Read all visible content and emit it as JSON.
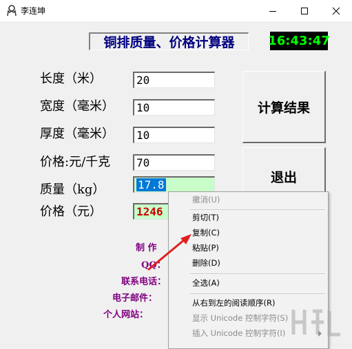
{
  "window": {
    "title": "李连坤",
    "icons": {
      "app": "person-icon",
      "minimize": "minimize-icon",
      "maximize": "maximize-icon",
      "close": "close-icon"
    }
  },
  "header": {
    "heading": "铜排质量、价格计算器",
    "clock": "16:43:47"
  },
  "form": {
    "length_label": "长度（米）",
    "length_value": "20",
    "width_label": "宽度（毫米）",
    "width_value": "10",
    "thickness_label": "厚度（毫米）",
    "thickness_value": "10",
    "price_label": "价格:元/千克",
    "price_value": "70",
    "mass_label": "质量（kg）",
    "mass_value": "17.8",
    "total_label": "价格（元）",
    "total_value": "1246"
  },
  "buttons": {
    "calculate": "计算结果",
    "exit": "退出"
  },
  "info": {
    "author": "制 作",
    "qq": "QQ：",
    "phone": "联系电话：",
    "email": "电子邮件：",
    "website": "个人网站："
  },
  "context_menu": {
    "items": [
      {
        "label": "撤消(U)",
        "enabled": false
      },
      {
        "label": "剪切(T)",
        "enabled": true
      },
      {
        "label": "复制(C)",
        "enabled": true
      },
      {
        "label": "粘贴(P)",
        "enabled": true
      },
      {
        "label": "删除(D)",
        "enabled": true
      },
      {
        "label": "全选(A)",
        "enabled": true
      },
      {
        "label": "从右到左的阅读顺序(R)",
        "enabled": true
      },
      {
        "label": "显示 Unicode 控制字符(S)",
        "enabled": false
      },
      {
        "label": "插入 Unicode 控制字符(I)",
        "enabled": false
      }
    ],
    "submenu_arrow_icon": "chevron-right-icon"
  },
  "colors": {
    "heading_text": "#000080",
    "clock_bg": "#000000",
    "clock_text": "#00ff00",
    "result_bg": "#c8fcc8",
    "info_text": "#800080",
    "arrow": "#e02020",
    "selection": "#0078d7"
  }
}
